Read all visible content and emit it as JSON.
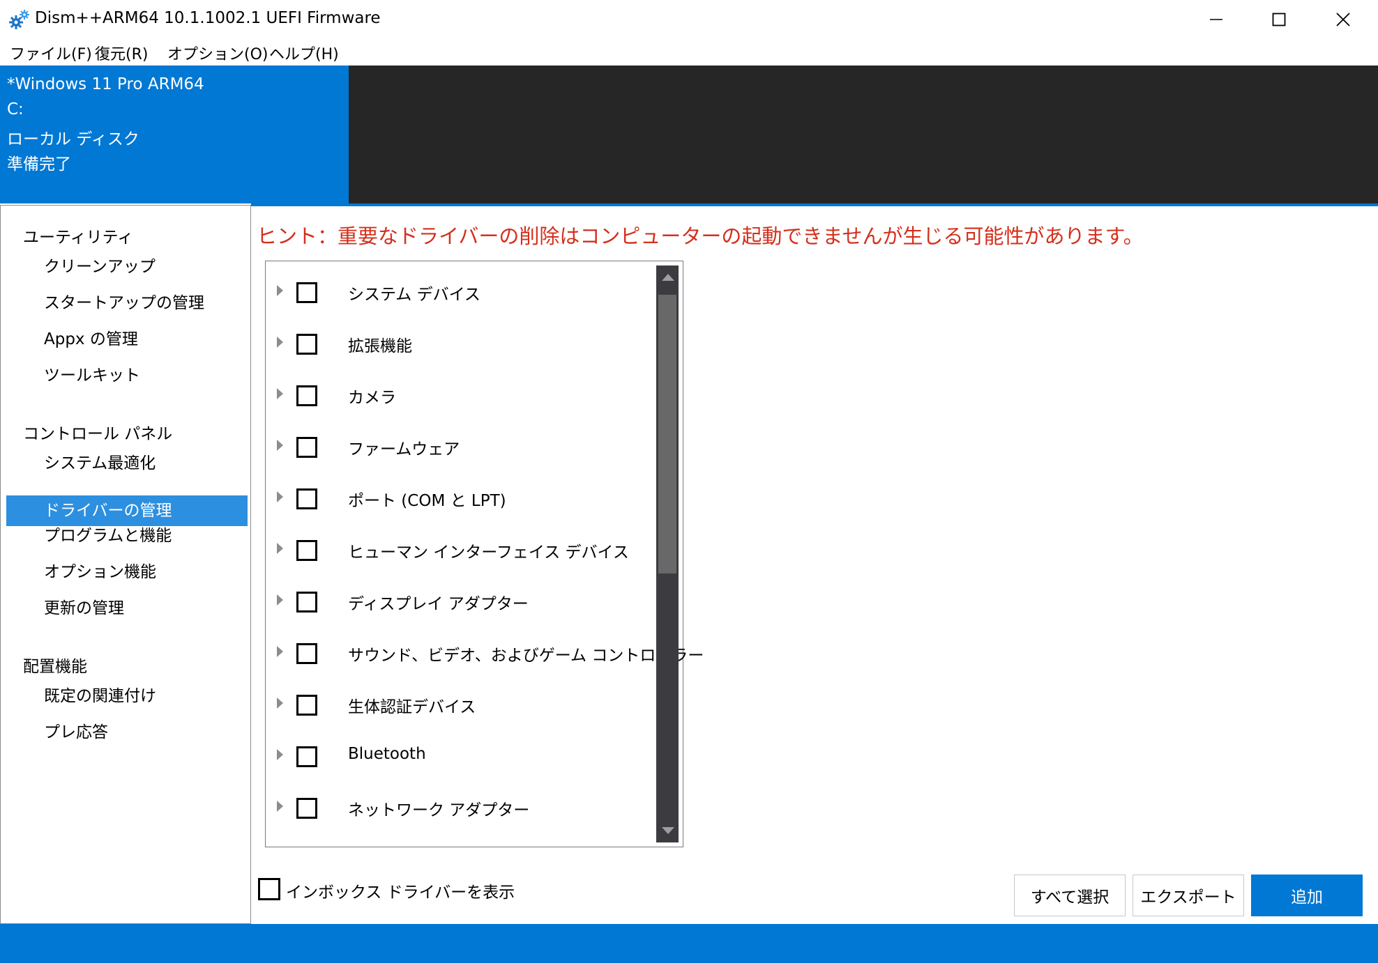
{
  "window": {
    "title": "Dism++ARM64 10.1.1002.1 UEFI Firmware",
    "icon": "gear-icon",
    "controls": [
      "minimize-icon",
      "maximize-icon",
      "close-icon"
    ]
  },
  "menu": {
    "items": [
      "ファイル(F)",
      "復元(R)",
      "オプション(O)",
      "ヘルプ(H)"
    ]
  },
  "image_info": {
    "name": "*Windows 11 Pro ARM64",
    "drive": "C:",
    "disk": "ローカル ディスク",
    "status": "準備完了"
  },
  "sidebar": {
    "categories": [
      {
        "label": "ユーティリティ",
        "items": [
          "クリーンアップ",
          "スタートアップの管理",
          "Appx の管理",
          "ツールキット"
        ]
      },
      {
        "label": "コントロール パネル",
        "items": [
          "システム最適化",
          "ドライバーの管理",
          "プログラムと機能",
          "オプション機能",
          "更新の管理"
        ]
      },
      {
        "label": "配置機能",
        "items": [
          "既定の関連付け",
          "プレ応答"
        ]
      }
    ],
    "active_item": "ドライバーの管理"
  },
  "hint": "ヒント：重要なドライバーの削除はコンピューターの起動できませんが生じる可能性があります。",
  "driver_list": {
    "rows": [
      {
        "label": "システム デバイス",
        "checked": false
      },
      {
        "label": "拡張機能",
        "checked": false
      },
      {
        "label": "カメラ",
        "checked": false
      },
      {
        "label": "ファームウェア",
        "checked": false
      },
      {
        "label": "ポート (COM と LPT)",
        "checked": false
      },
      {
        "label": "ヒューマン インターフェイス デバイス",
        "checked": false
      },
      {
        "label": "ディスプレイ アダプター",
        "checked": false
      },
      {
        "label": "サウンド、ビデオ、およびゲーム コントローラー",
        "checked": false
      },
      {
        "label": "生体認証デバイス",
        "checked": false
      },
      {
        "label": "Bluetooth",
        "checked": false
      },
      {
        "label": "ネットワーク アダプター",
        "checked": false
      }
    ]
  },
  "bottom": {
    "show_inbox_label": "インボックス ドライバーを表示",
    "show_inbox_checked": false,
    "select_all": "すべて選択",
    "export": "エクスポート",
    "add": "追加"
  },
  "colors": {
    "accent": "#0078d4",
    "hint": "#d42f1c",
    "active_item": "#2d8fdf",
    "dark_panel": "#262626"
  }
}
